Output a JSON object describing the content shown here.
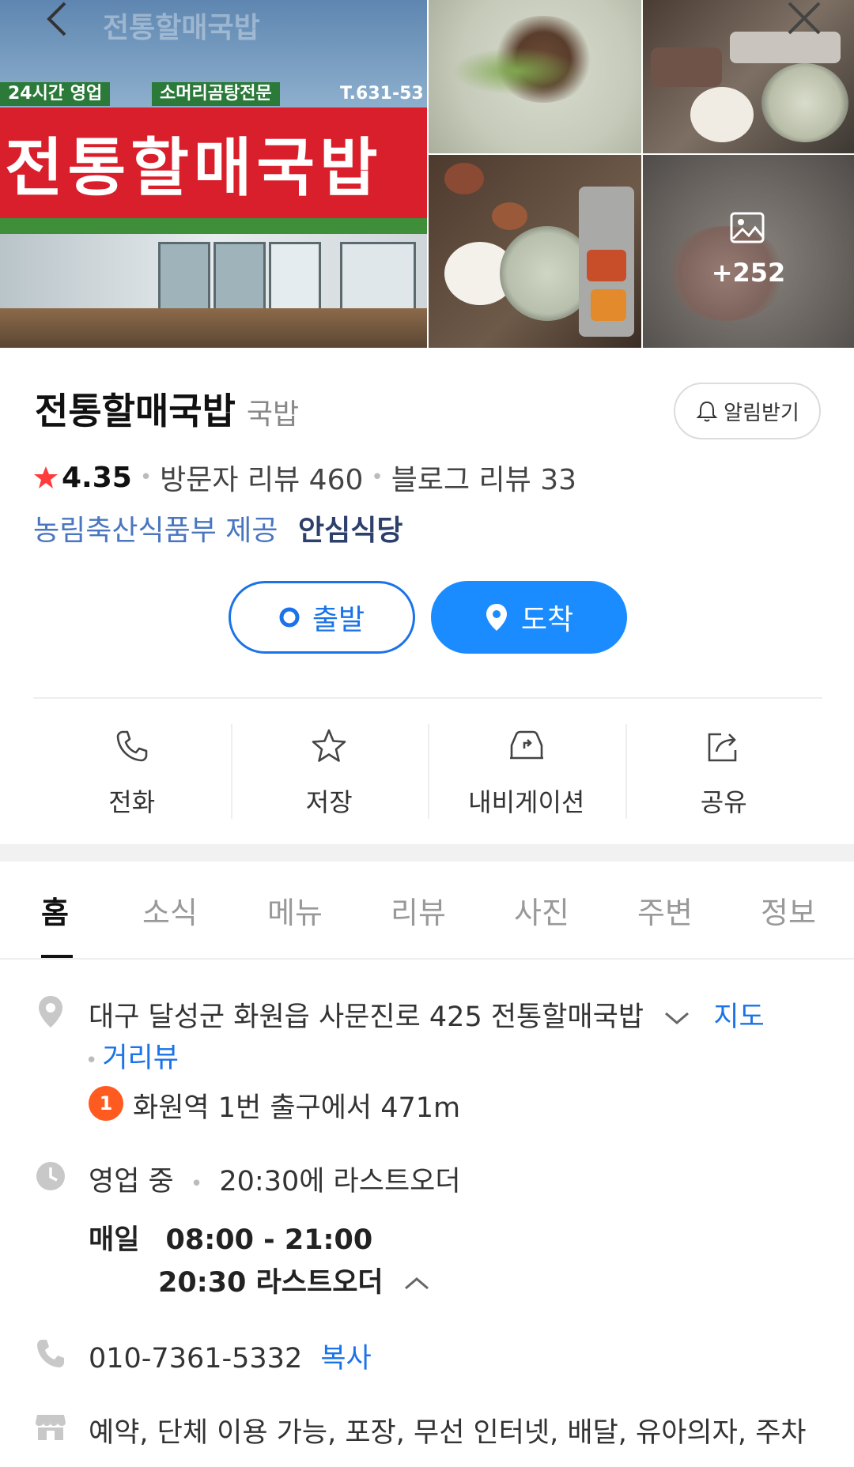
{
  "header": {
    "back_title": "전통할매국밥",
    "more_photos": "+252"
  },
  "sign": {
    "main": "전통할매국밥",
    "tag_hours": "24시간 영업",
    "tag_specialty": "소머리곰탕전문",
    "tag_phone": "T.631-53"
  },
  "place": {
    "name": "전통할매국밥",
    "category": "국밥",
    "alarm_label": "알림받기",
    "rating": "4.35",
    "visitor_reviews": "방문자 리뷰 460",
    "blog_reviews": "블로그 리뷰 33",
    "cert_provider": "농림축산식품부 제공",
    "cert_badge": "안심식당"
  },
  "route": {
    "depart": "출발",
    "arrive": "도착"
  },
  "actions": [
    {
      "label": "전화",
      "icon": "phone-icon"
    },
    {
      "label": "저장",
      "icon": "star-icon"
    },
    {
      "label": "내비게이션",
      "icon": "car-navigation-icon"
    },
    {
      "label": "공유",
      "icon": "share-icon"
    }
  ],
  "tabs": [
    "홈",
    "소식",
    "메뉴",
    "리뷰",
    "사진",
    "주변",
    "정보"
  ],
  "info": {
    "address": "대구 달성군 화원읍 사문진로 425 전통할매국밥",
    "map_link": "지도",
    "street_view_link": "거리뷰",
    "station_num": "1",
    "station_text": "화원역 1번 출구에서 471m",
    "status": "영업 중",
    "last_order_note": "20:30에 라스트오더",
    "day_label": "매일",
    "hours": "08:00 - 21:00",
    "last_order": "20:30 라스트오더",
    "phone": "010-7361-5332",
    "copy_label": "복사",
    "amenities": "예약, 단체 이용 가능, 포장, 무선 인터넷, 배달, 유아의자, 주차"
  },
  "colors": {
    "accent_blue": "#1a8cff",
    "link_blue": "#1a73e8",
    "star_red": "#ff3b3b",
    "badge_orange": "#ff5a1f"
  }
}
